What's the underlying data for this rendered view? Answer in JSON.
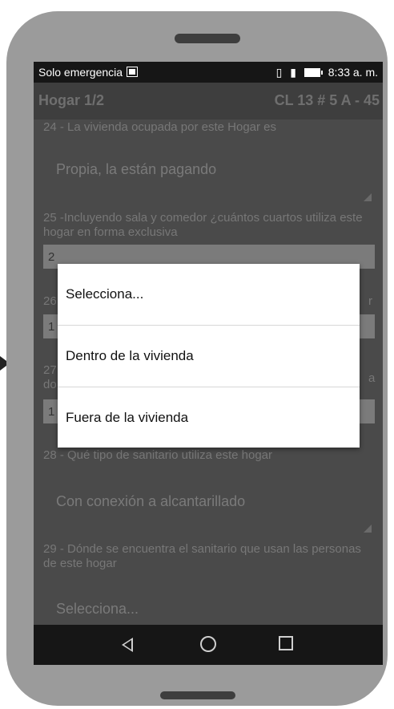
{
  "status_bar": {
    "carrier": "Solo emergencia",
    "time": "8:33 a. m."
  },
  "header": {
    "title": "Hogar 1/2",
    "address": "CL 13 # 5 A - 45"
  },
  "questions": {
    "q24": {
      "label": "24 - La vivienda ocupada por este Hogar es",
      "value": "Propia, la están pagando"
    },
    "q25": {
      "label": "25 -Incluyendo sala y comedor ¿cuántos cuartos utiliza este hogar en forma exclusiva",
      "value": "2"
    },
    "q26": {
      "label_fragment": "26",
      "value_fragment": "1",
      "right_fragment": "r"
    },
    "q27": {
      "label_fragment": "27",
      "label_fragment_line2": "do",
      "value_fragment": "1",
      "right_fragment": "a"
    },
    "q28": {
      "label": "28 - Qué tipo de sanitario utiliza este hogar",
      "value": "Con conexión a alcantarillado"
    },
    "q29": {
      "label": "29 - Dónde se encuentra el sanitario que usan las personas de este hogar",
      "value": "Selecciona..."
    }
  },
  "dialog": {
    "options": [
      "Selecciona...",
      "Dentro de la vivienda",
      "Fuera de la vivienda"
    ]
  },
  "icons": {
    "back": "back-triangle-icon",
    "home": "home-circle-icon",
    "recents": "recents-square-icon"
  }
}
